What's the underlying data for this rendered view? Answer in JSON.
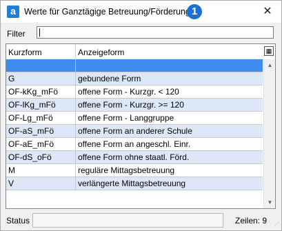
{
  "window": {
    "title": "Werte für Ganztägige Betreuung/Förderung",
    "app_icon_letter": "a",
    "badge": "1",
    "close_glyph": "✕"
  },
  "filter": {
    "label": "Filter",
    "value": ""
  },
  "grid": {
    "columns": [
      "Kurzform",
      "Anzeigeform"
    ],
    "column_chooser_glyph": "▦",
    "rows": [
      {
        "kurzform": "",
        "anzeigeform": "",
        "selected": true
      },
      {
        "kurzform": "G",
        "anzeigeform": "gebundene Form"
      },
      {
        "kurzform": "OF-kKg_mFö",
        "anzeigeform": "offene Form - Kurzgr. < 120"
      },
      {
        "kurzform": "OF-lKg_mFö",
        "anzeigeform": "offene Form - Kurzgr. >= 120"
      },
      {
        "kurzform": "OF-Lg_mFö",
        "anzeigeform": "offene Form - Langgruppe"
      },
      {
        "kurzform": "OF-aS_mFö",
        "anzeigeform": "offene Form an anderer Schule"
      },
      {
        "kurzform": "OF-aE_mFö",
        "anzeigeform": "offene Form an angeschl. Einr."
      },
      {
        "kurzform": "OF-dS_oFö",
        "anzeigeform": "offene Form ohne staatl. Förd."
      },
      {
        "kurzform": "M",
        "anzeigeform": "reguläre Mittagsbetreuung"
      },
      {
        "kurzform": "V",
        "anzeigeform": "verlängerte Mittagsbetreuung"
      }
    ]
  },
  "status": {
    "label": "Status",
    "value": "",
    "row_count": "Zeilen: 9"
  },
  "icons": {
    "scroll_up": "▲",
    "scroll_down": "▼",
    "resize_grip": "⋰"
  },
  "colors": {
    "selection": "#3f8cf0",
    "alternate_row": "#dce8f8",
    "badge": "#1d6fd0"
  }
}
